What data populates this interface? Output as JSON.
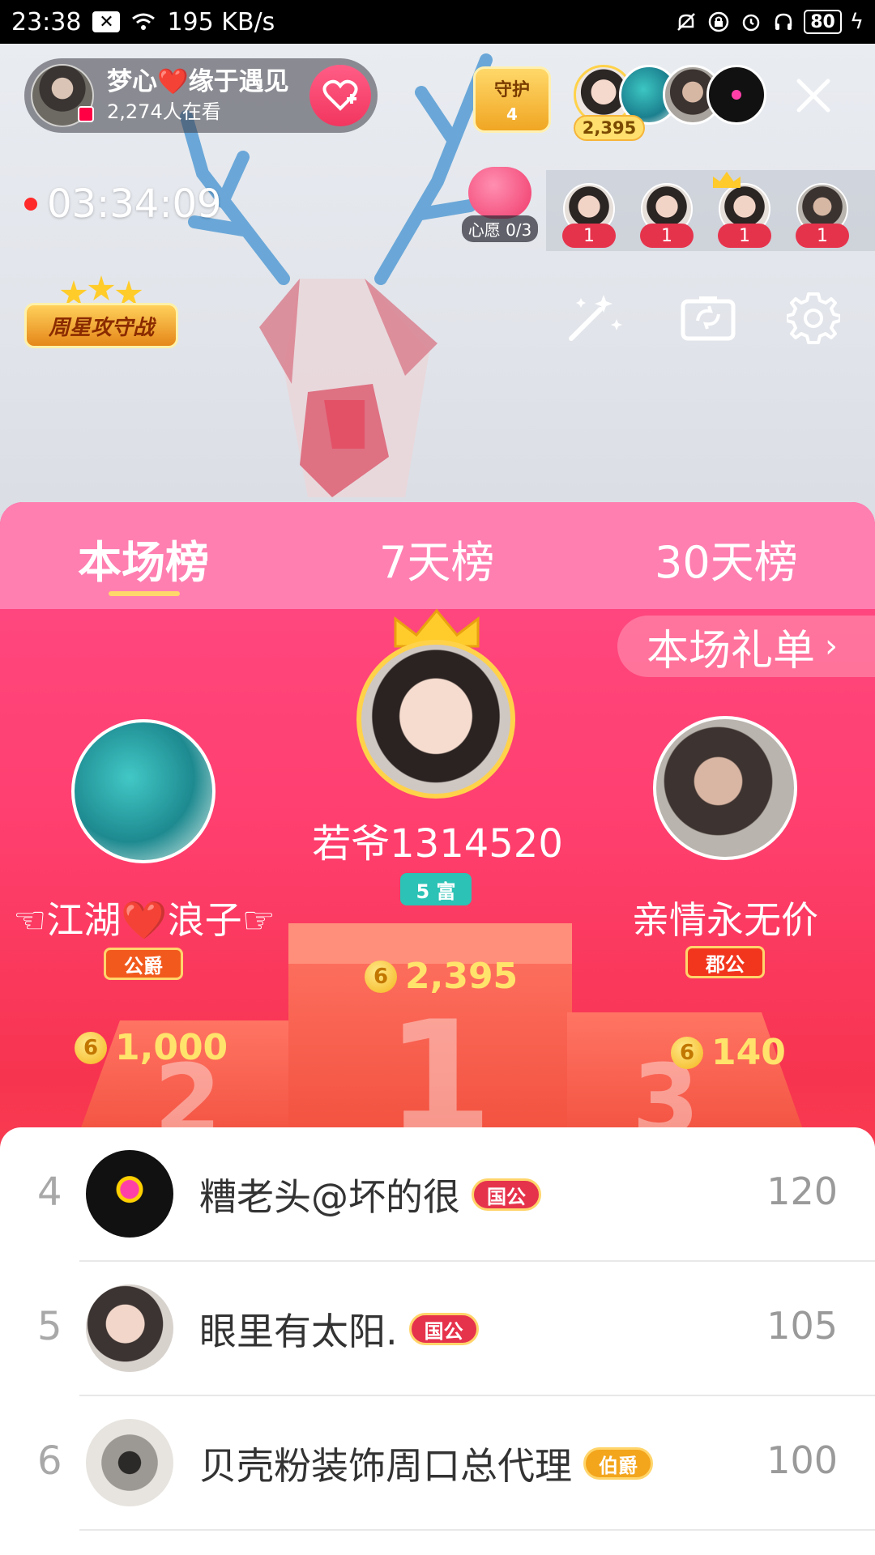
{
  "status_bar": {
    "time": "23:38",
    "network_speed": "195 KB/s",
    "battery": "80",
    "icons": [
      "notification-x-icon",
      "wifi-icon",
      "mute-icon",
      "lock-icon",
      "alarm-icon",
      "headphones-icon",
      "battery-icon",
      "charging-icon"
    ]
  },
  "host": {
    "name": "梦心❤️缘于遇见",
    "viewers": "2,274人在看"
  },
  "guard": {
    "label": "守护",
    "count": "4"
  },
  "top_viewers": {
    "score": "2,395"
  },
  "live_timer": "03:34:09",
  "wish": {
    "label": "心愿 0/3"
  },
  "seats": [
    {
      "num": "1"
    },
    {
      "num": "1"
    },
    {
      "num": "1"
    },
    {
      "num": "1"
    }
  ],
  "weekly_star": {
    "label": "周星攻守战"
  },
  "tabs": [
    {
      "label": "本场榜",
      "active": true
    },
    {
      "label": "7天榜",
      "active": false
    },
    {
      "label": "30天榜",
      "active": false
    }
  ],
  "gift_list_label": "本场礼单",
  "podium": {
    "first": {
      "name": "若爷1314520",
      "badge": "5 富",
      "coins": "2,395",
      "place": "1"
    },
    "second": {
      "name": "☜江湖❤️浪子☞",
      "badge": "公爵",
      "coins": "1,000",
      "place": "2"
    },
    "third": {
      "name": "亲情永无价",
      "badge": "郡公",
      "coins": "140",
      "place": "3"
    }
  },
  "coin_symbol": "6",
  "list": [
    {
      "rank": "4",
      "name": "糟老头@坏的很",
      "badge": "国公",
      "score": "120"
    },
    {
      "rank": "5",
      "name": "眼里有太阳.",
      "badge": "国公",
      "score": "105"
    },
    {
      "rank": "6",
      "name": "贝壳粉装饰周口总代理",
      "badge": "伯爵",
      "score": "100"
    }
  ],
  "colors": {
    "accent_pink": "#ff4a86",
    "tab_bar": "#ff7fb1",
    "coin_gold": "#ffe36b",
    "badge_red": "#e6334c"
  }
}
